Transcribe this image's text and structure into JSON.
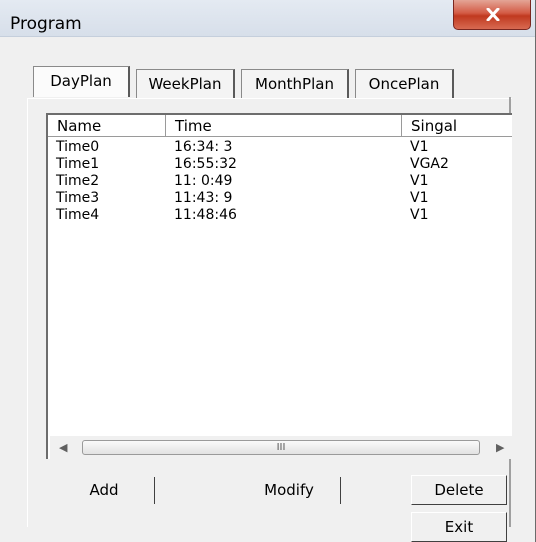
{
  "window": {
    "title": "Program"
  },
  "tabs": [
    {
      "label": "DayPlan"
    },
    {
      "label": "WeekPlan"
    },
    {
      "label": "MonthPlan"
    },
    {
      "label": "OncePlan"
    }
  ],
  "list": {
    "columns": [
      {
        "label": "Name"
      },
      {
        "label": "Time"
      },
      {
        "label": "Singal"
      }
    ],
    "rows": [
      {
        "name": "Time0",
        "time": "16:34: 3",
        "signal": "V1"
      },
      {
        "name": "Time1",
        "time": "16:55:32",
        "signal": "VGA2"
      },
      {
        "name": "Time2",
        "time": "11: 0:49",
        "signal": "V1"
      },
      {
        "name": "Time3",
        "time": "11:43: 9",
        "signal": "V1"
      },
      {
        "name": "Time4",
        "time": "11:48:46",
        "signal": "V1"
      }
    ],
    "scroll_thumb_grip": "III"
  },
  "buttons": {
    "add": "Add",
    "modify": "Modify",
    "delete": "Delete",
    "exit": "Exit"
  },
  "colors": {
    "close_button": "#c0391f",
    "title_bar": "#dde4ee"
  }
}
